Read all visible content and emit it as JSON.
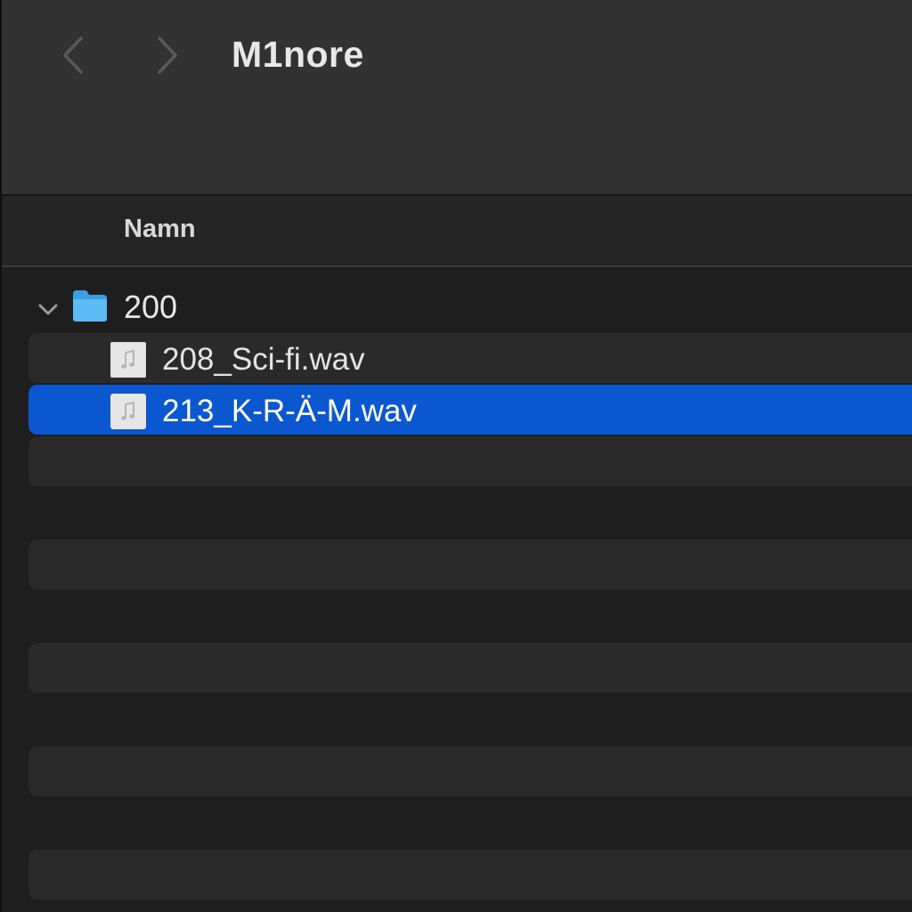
{
  "toolbar": {
    "title": "M1nore",
    "back_icon": "chevron-left-icon",
    "forward_icon": "chevron-right-icon"
  },
  "columns": {
    "name_header": "Namn"
  },
  "tree": {
    "folder": {
      "name": "200",
      "expanded": true,
      "icon": "folder-icon",
      "color": "#4fb3f0"
    },
    "files": [
      {
        "name": "208_Sci-fi.wav",
        "icon": "audio-file-icon",
        "selected": false
      },
      {
        "name": "213_K-R-Ä-M.wav",
        "icon": "audio-file-icon",
        "selected": true
      }
    ]
  },
  "colors": {
    "selection": "#0b57d0",
    "toolbar_bg": "#323233",
    "list_bg": "#1e1e1f",
    "stripe_bg": "#2a2a2b"
  }
}
